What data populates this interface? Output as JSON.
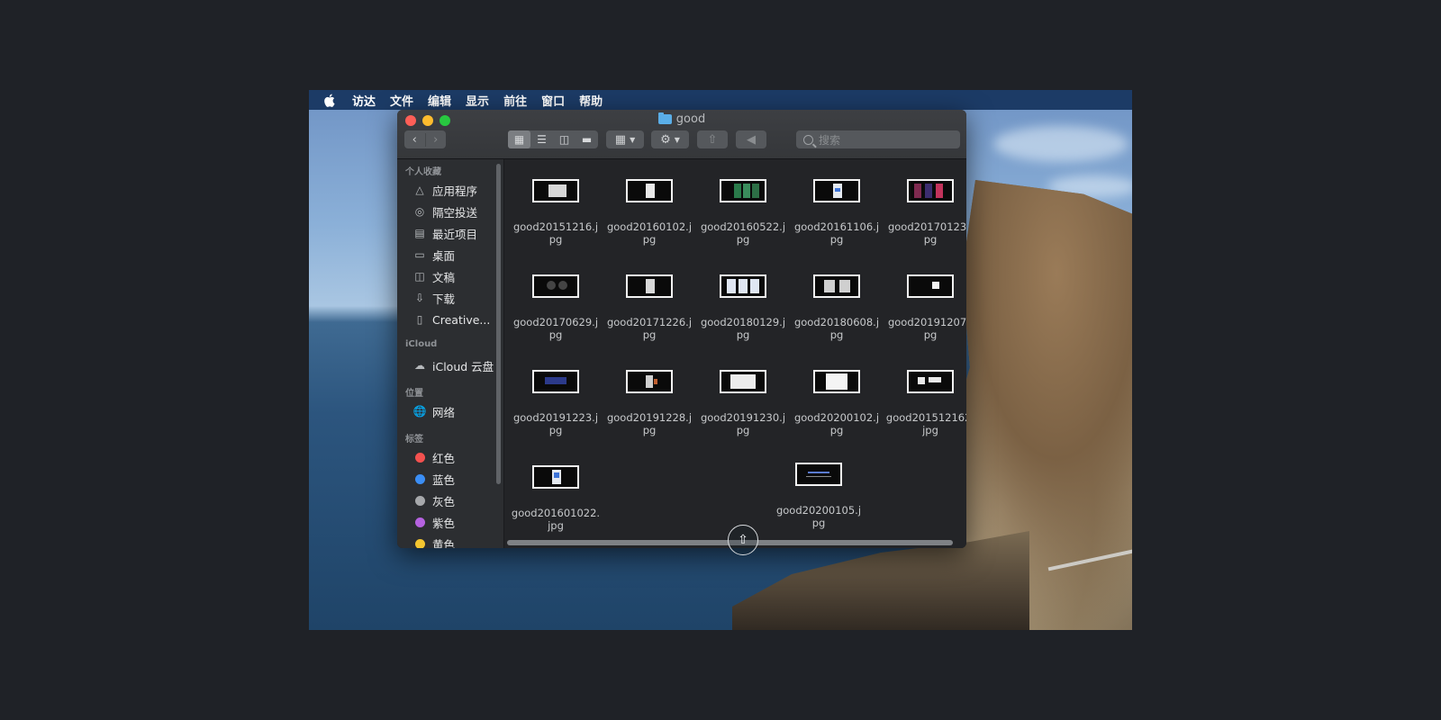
{
  "menubar": {
    "apple_icon": "apple-icon",
    "items": [
      "访达",
      "文件",
      "编辑",
      "显示",
      "前往",
      "窗口",
      "帮助"
    ]
  },
  "window": {
    "title": "good",
    "search_placeholder": "搜索"
  },
  "sidebar": {
    "favorites_header": "个人收藏",
    "favorites": [
      {
        "label": "应用程序",
        "icon": "applications-icon"
      },
      {
        "label": "隔空投送",
        "icon": "airdrop-icon"
      },
      {
        "label": "最近项目",
        "icon": "recents-icon"
      },
      {
        "label": "桌面",
        "icon": "desktop-icon"
      },
      {
        "label": "文稿",
        "icon": "documents-icon"
      },
      {
        "label": "下载",
        "icon": "downloads-icon"
      },
      {
        "label": "Creative...",
        "icon": "folder-icon"
      }
    ],
    "icloud_header": "iCloud",
    "icloud": [
      {
        "label": "iCloud 云盘",
        "icon": "cloud-icon"
      }
    ],
    "locations_header": "位置",
    "locations": [
      {
        "label": "网络",
        "icon": "network-icon"
      }
    ],
    "tags_header": "标签",
    "tags": [
      {
        "label": "红色",
        "color": "#f4514f"
      },
      {
        "label": "蓝色",
        "color": "#3b8ef5"
      },
      {
        "label": "灰色",
        "color": "#a6a8ab"
      },
      {
        "label": "紫色",
        "color": "#b562e0"
      },
      {
        "label": "黄色",
        "color": "#f4c630"
      }
    ]
  },
  "files": [
    "good20151216.jpg",
    "good20160102.jpg",
    "good20160522.jpg",
    "good20161106.jpg",
    "good20170123.jpg",
    "good20170629.jpg",
    "good20171226.jpg",
    "good20180129.jpg",
    "good20180608.jpg",
    "good20191207.jpg",
    "good20191223.jpg",
    "good20191228.jpg",
    "good20191230.jpg",
    "good20200102.jpg",
    "good201512162.jpg",
    "good201601022.jpg",
    "good20200105.jpg"
  ]
}
